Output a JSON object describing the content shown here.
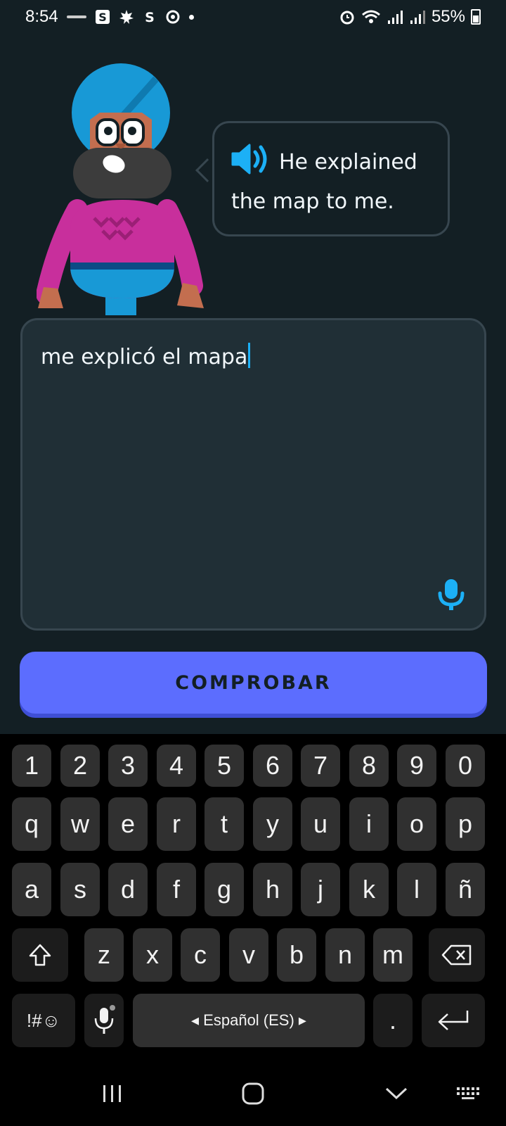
{
  "status_bar": {
    "time": "8:54",
    "battery": "55%"
  },
  "prompt": {
    "sentence_line1": "He explained",
    "sentence_line2": "the map to me."
  },
  "answer": {
    "text": "me explicó el mapa"
  },
  "check_button": {
    "label": "COMPROBAR"
  },
  "keyboard": {
    "number_row": [
      "1",
      "2",
      "3",
      "4",
      "5",
      "6",
      "7",
      "8",
      "9",
      "0"
    ],
    "row1": [
      "q",
      "w",
      "e",
      "r",
      "t",
      "y",
      "u",
      "i",
      "o",
      "p"
    ],
    "row2": [
      "a",
      "s",
      "d",
      "f",
      "g",
      "h",
      "j",
      "k",
      "l",
      "ñ"
    ],
    "row3": [
      "z",
      "x",
      "c",
      "v",
      "b",
      "n",
      "m"
    ],
    "symbols_label": "!#☺",
    "space_label": "◂  Español (ES)  ▸",
    "period_label": "."
  },
  "colors": {
    "background": "#131f24",
    "button": "#5c6dfe",
    "accent": "#1cb0f6"
  },
  "icons": {
    "speaker": "speaker-icon",
    "microphone": "microphone-icon",
    "shift": "shift-icon",
    "backspace": "backspace-icon",
    "enter": "enter-icon"
  }
}
